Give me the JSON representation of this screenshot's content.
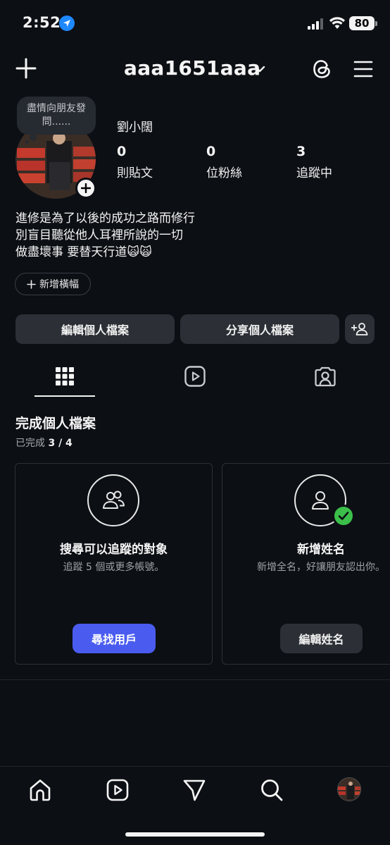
{
  "status_bar": {
    "time": "2:52",
    "battery": "80"
  },
  "header": {
    "username": "aaa1651aaa",
    "icons": [
      "plus-icon",
      "chevron-down-icon",
      "threads-icon",
      "menu-icon"
    ]
  },
  "profile": {
    "note": "盡情向朋友發問......",
    "display_name": "劉小闊",
    "stats": [
      {
        "value": "0",
        "label": "則貼文"
      },
      {
        "value": "0",
        "label": "位粉絲"
      },
      {
        "value": "3",
        "label": "追蹤中"
      }
    ],
    "bio_lines": [
      "進修是為了以後的成功之路而修行",
      "別盲目聽從他人耳裡所說的一切",
      "做盡壞事 要替天行道🙀🙀"
    ],
    "add_banner_label": "新增橫幅"
  },
  "actions": {
    "edit_profile": "編輯個人檔案",
    "share_profile": "分享個人檔案"
  },
  "tabs": [
    "grid-icon",
    "reels-icon",
    "tagged-icon"
  ],
  "complete_profile": {
    "title": "完成個人檔案",
    "progress_prefix": "已完成",
    "progress": "3 / 4",
    "cards": [
      {
        "title": "搜尋可以追蹤的對象",
        "description": "追蹤 5 個或更多帳號。",
        "button": "尋找用戶",
        "completed": false
      },
      {
        "title": "新增姓名",
        "description": "新增全名，好讓朋友認出你。",
        "button": "編輯姓名",
        "completed": true
      }
    ]
  },
  "bottom_nav": [
    "home-icon",
    "reels-icon",
    "send-icon",
    "search-icon",
    "profile-avatar"
  ],
  "colors": {
    "background": "#0c0f14",
    "button": "#2c3036",
    "primary_button": "#4a5cf0",
    "check": "#3bbf4a",
    "location": "#1e88ff"
  }
}
